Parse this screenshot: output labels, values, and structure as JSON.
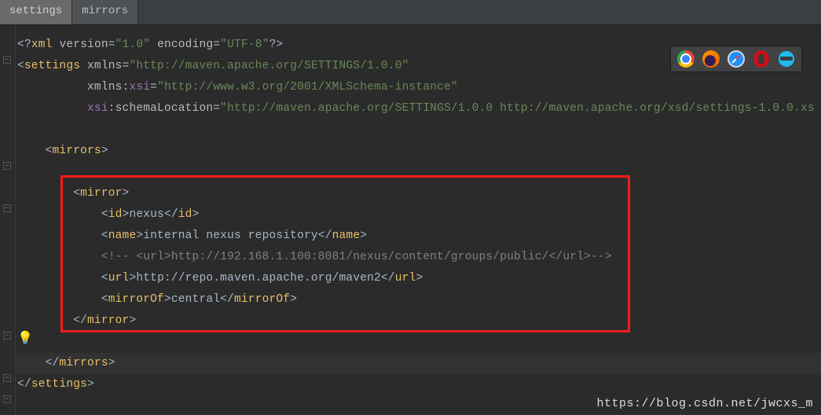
{
  "tabs": {
    "t0": "settings",
    "t1": "mirrors"
  },
  "xml": {
    "decl_version": "\"1.0\"",
    "decl_encoding": "\"UTF-8\"",
    "ns_default": "\"http://maven.apache.org/SETTINGS/1.0.0\"",
    "ns_xsi": "\"http://www.w3.org/2001/XMLSchema-instance\"",
    "xsi_schemaLocation": "\"http://maven.apache.org/SETTINGS/1.0.0 http://maven.apache.org/xsd/settings-1.0.0.xs",
    "mirror": {
      "id": "nexus",
      "name": "internal nexus repository",
      "comment": "<!-- <url>http://192.168.1.100:8081/nexus/content/groups/public/</url>-->",
      "url": "http://repo.maven.apache.org/maven2",
      "mirrorOf": "central"
    }
  },
  "watermark": "https://blog.csdn.net/jwcxs_m"
}
